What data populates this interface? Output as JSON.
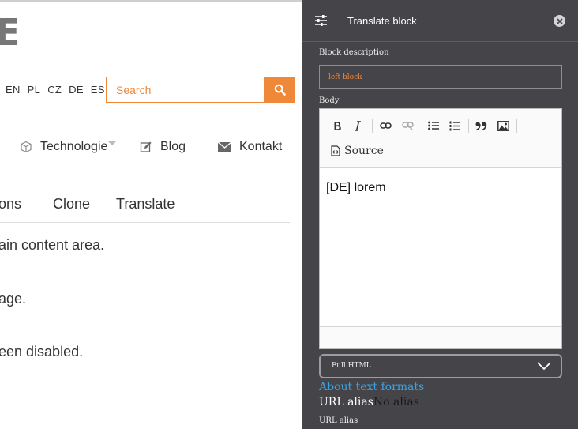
{
  "site": {
    "logo_fragment": "E",
    "languages": [
      "EN",
      "PL",
      "CZ",
      "DE",
      "ES"
    ],
    "search": {
      "placeholder": "Search"
    },
    "nav": {
      "technologie": "Technologie",
      "blog": "Blog",
      "kontakt": "Kontakt"
    },
    "tabs": {
      "revisions": "ions",
      "clone": "Clone",
      "translate": "Translate"
    },
    "messages": [
      "ain content area.",
      "age.",
      "een disabled."
    ]
  },
  "panel": {
    "title": "Translate block",
    "description_label": "Block description",
    "description_value": "left block",
    "body_label": "Body",
    "source_label": "Source",
    "editor_content": "[DE] lorem",
    "text_format": "Full HTML",
    "about_link": "About text formats",
    "url_alias_summary_label": "URL alias",
    "url_alias_summary_value": "No alias",
    "url_alias_label": "URL alias"
  },
  "colors": {
    "accent": "#f0883a",
    "panel_bg": "#454549",
    "link": "#3aa3e3"
  },
  "icons": {
    "search": "search-icon",
    "cube": "cube-icon",
    "edit": "edit-icon",
    "mail": "mail-icon",
    "settings": "settings-sliders-icon",
    "close": "close-icon",
    "bold": "bold-icon",
    "italic": "italic-icon",
    "link": "link-icon",
    "unlink": "unlink-icon",
    "bulleted_list": "bulleted-list-icon",
    "numbered_list": "numbered-list-icon",
    "blockquote": "blockquote-icon",
    "image": "image-icon",
    "source": "source-icon",
    "chevron": "chevron-down-icon"
  }
}
